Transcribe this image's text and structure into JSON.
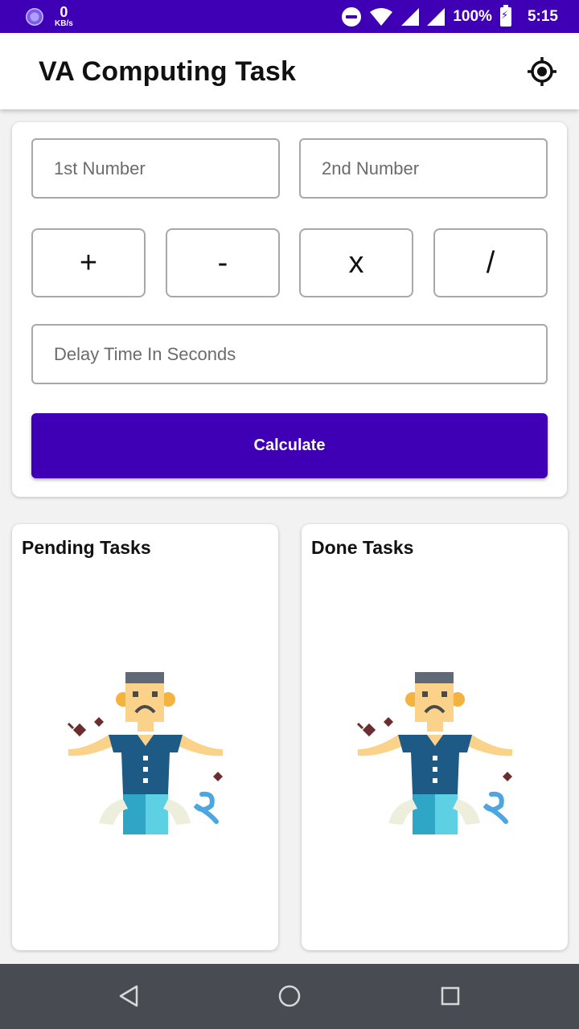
{
  "status_bar": {
    "net_speed_value": "0",
    "net_speed_unit": "KB/s",
    "battery": "100%",
    "time": "5:15"
  },
  "app_bar": {
    "title": "VA Computing Task",
    "locate_icon": "gps-locate-icon"
  },
  "form": {
    "first_number_placeholder": "1st Number",
    "second_number_placeholder": "2nd Number",
    "operators": [
      "+",
      "-",
      "x",
      "/"
    ],
    "delay_placeholder": "Delay Time In Seconds",
    "calculate_label": "Calculate"
  },
  "pending": {
    "title": "Pending Tasks",
    "illustration": "empty-pockets-man-illustration"
  },
  "done": {
    "title": "Done Tasks",
    "illustration": "empty-pockets-man-illustration"
  },
  "nav": {
    "back": "back-triangle-icon",
    "home": "home-circle-icon",
    "recents": "recents-square-icon"
  },
  "colors": {
    "primary": "#3f00b5",
    "navbar": "#484c52"
  }
}
